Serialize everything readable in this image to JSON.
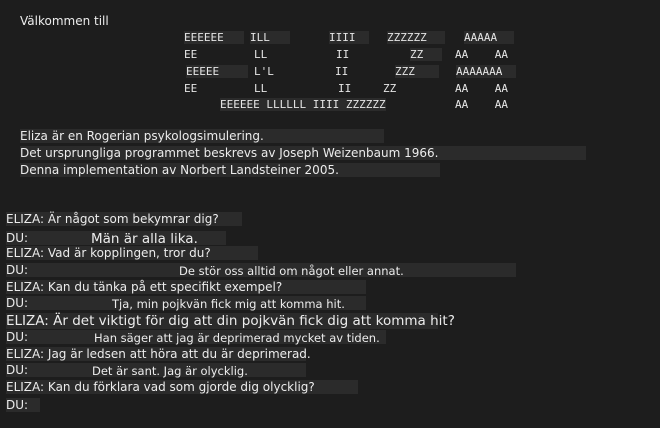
{
  "welcome": "Välkommen till",
  "logo": {
    "e": [
      "EEEEEE",
      "EE",
      "EEEEE",
      "EE"
    ],
    "l": [
      "ILL",
      "LL",
      "L'L",
      "LL"
    ],
    "i": [
      "IIII",
      "II",
      "II",
      "II"
    ],
    "z": [
      "ZZZZZZ",
      "ZZ",
      "ZZZ",
      "ZZ"
    ],
    "a": [
      "AAAAA",
      "AA    AA",
      "AAAAAAA",
      "AA    AA"
    ],
    "bottom": "EEEEEE LLLLLL IIII ZZZZZZ",
    "a_last": "AA    AA"
  },
  "intro": [
    "Eliza är en Rogerian psykologsimulering.",
    "Det ursprungliga programmet beskrevs av Joseph Weizenbaum 1966.",
    "Denna implementation av Norbert Landsteiner 2005."
  ],
  "conversation": [
    {
      "speaker": "ELIZA:",
      "text": "Är något som bekymrar dig?"
    },
    {
      "speaker": "DU:",
      "text": "Män är alla lika."
    },
    {
      "speaker": "ELIZA:",
      "text": "Vad är kopplingen, tror du?"
    },
    {
      "speaker": "DU:",
      "text": "De stör oss alltid om något eller annat."
    },
    {
      "speaker": "ELIZA:",
      "text": "Kan du tänka på ett specifikt exempel?"
    },
    {
      "speaker": "DU:",
      "text": "Tja, min pojkvän fick mig att komma hit."
    },
    {
      "speaker": "ELIZA:",
      "text": "Är det viktigt för dig att din pojkvän fick dig att komma hit?"
    },
    {
      "speaker": "DU:",
      "text": "Han säger att jag är deprimerad mycket av tiden."
    },
    {
      "speaker": "ELIZA:",
      "text": "Jag är ledsen att höra att du är deprimerad."
    },
    {
      "speaker": "DU:",
      "text": "Det är sant. Jag är olycklig."
    },
    {
      "speaker": "ELIZA:",
      "text": "Kan du förklara vad som gjorde dig olycklig?"
    },
    {
      "speaker": "DU:",
      "text": ""
    }
  ],
  "colors": {
    "background": "#1d1d1d",
    "text": "#ececec",
    "highlight": "#2b2b2b"
  }
}
